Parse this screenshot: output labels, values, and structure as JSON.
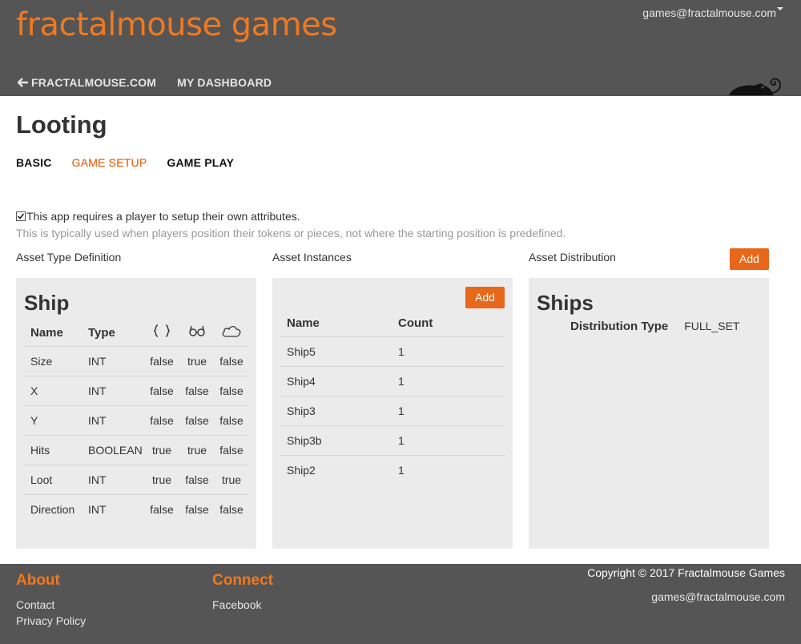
{
  "header": {
    "brand": "fractalmouse games",
    "user_email": "games@fractalmouse.com",
    "nav": [
      "FRACTALMOUSE.COM",
      "MY DASHBOARD"
    ]
  },
  "page": {
    "title": "Looting",
    "tabs": [
      "BASIC",
      "GAME SETUP",
      "GAME PLAY"
    ],
    "active_tab": "GAME SETUP"
  },
  "setup": {
    "requires_attrs_checked": true,
    "requires_attrs_label": "This app requires a player to setup their own attributes.",
    "hint": "This is typically used when players position their tokens or pieces, not where the starting position is predefined."
  },
  "asset_type": {
    "label": "Asset Type Definition",
    "title": "Ship",
    "columns": [
      "Name",
      "Type"
    ],
    "icon_columns": [
      "braces-icon",
      "glasses-icon",
      "cloud-icon"
    ],
    "rows": [
      [
        "Size",
        "INT",
        "false",
        "true",
        "false"
      ],
      [
        "X",
        "INT",
        "false",
        "false",
        "false"
      ],
      [
        "Y",
        "INT",
        "false",
        "false",
        "false"
      ],
      [
        "Hits",
        "BOOLEAN",
        "true",
        "true",
        "false"
      ],
      [
        "Loot",
        "INT",
        "true",
        "false",
        "true"
      ],
      [
        "Direction",
        "INT",
        "false",
        "false",
        "false"
      ]
    ]
  },
  "asset_instances": {
    "label": "Asset Instances",
    "add_label": "Add",
    "columns": [
      "Name",
      "Count"
    ],
    "rows": [
      [
        "Ship5",
        "1"
      ],
      [
        "Ship4",
        "1"
      ],
      [
        "Ship3",
        "1"
      ],
      [
        "Ship3b",
        "1"
      ],
      [
        "Ship2",
        "1"
      ]
    ]
  },
  "asset_distribution": {
    "label": "Asset Distribution",
    "add_label": "Add",
    "title": "Ships",
    "key": "Distribution Type",
    "value": "FULL_SET"
  },
  "footer": {
    "about_heading": "About",
    "about_links": [
      "Contact",
      "Privacy Policy"
    ],
    "connect_heading": "Connect",
    "connect_links": [
      "Facebook"
    ],
    "copyright": "Copyright © 2017 Fractalmouse Games",
    "email": "games@fractalmouse.com"
  },
  "colors": {
    "accent": "#e8681b",
    "header_bg": "#555555",
    "panel_bg": "#ebebeb"
  }
}
